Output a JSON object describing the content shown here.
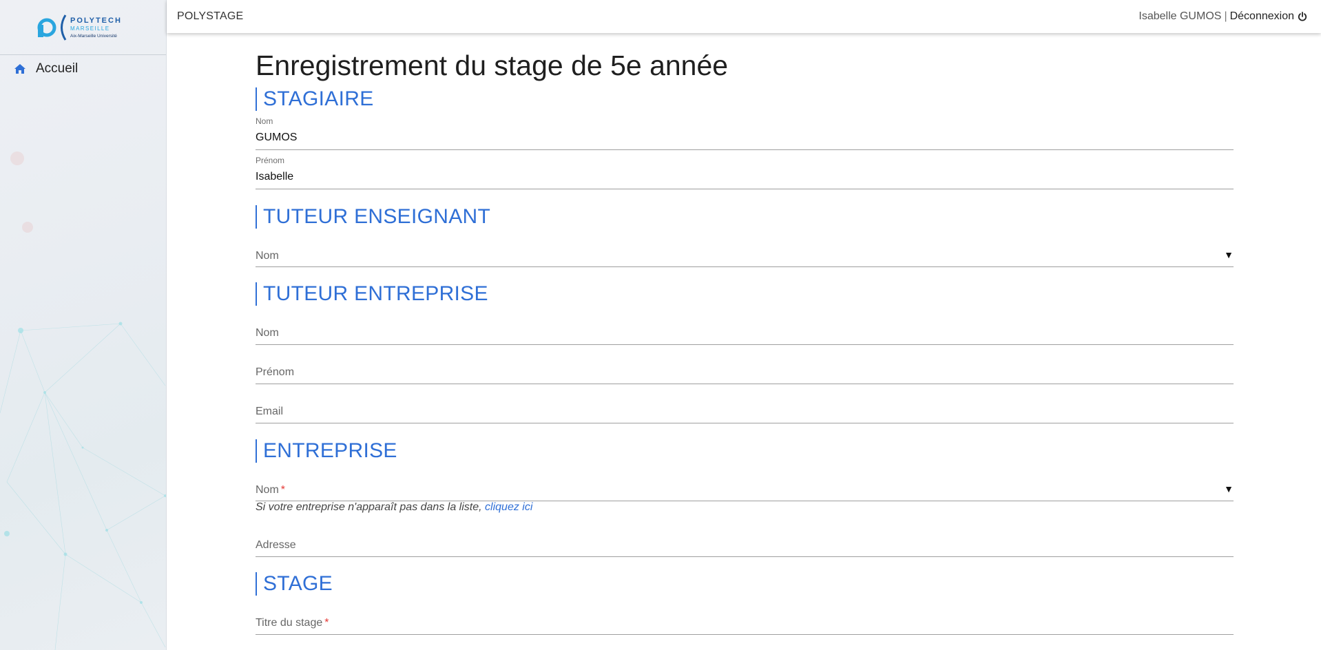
{
  "brand": {
    "logo_word": "POLYTECH",
    "logo_city": "MARSEILLE",
    "logo_univ": "Aix-Marseille Université",
    "primary_color": "#2f6fd6",
    "required_color": "#e53935"
  },
  "sidebar": {
    "items": [
      {
        "label": "Accueil",
        "icon": "home-icon"
      }
    ]
  },
  "topbar": {
    "app_name": "POLYSTAGE",
    "user_name": "Isabelle GUMOS",
    "separator": "|",
    "logout_label": "Déconnexion",
    "logout_icon": "power-icon"
  },
  "page": {
    "title": "Enregistrement du stage de 5e année"
  },
  "sections": {
    "stagiaire": {
      "title": "STAGIAIRE",
      "nom_label": "Nom",
      "nom_value": "GUMOS",
      "prenom_label": "Prénom",
      "prenom_value": "Isabelle"
    },
    "tuteur_enseignant": {
      "title": "TUTEUR ENSEIGNANT",
      "nom_placeholder": "Nom"
    },
    "tuteur_entreprise": {
      "title": "TUTEUR ENTREPRISE",
      "nom_placeholder": "Nom",
      "prenom_placeholder": "Prénom",
      "email_placeholder": "Email"
    },
    "entreprise": {
      "title": "ENTREPRISE",
      "nom_placeholder": "Nom",
      "required_mark": "*",
      "hint_text": "Si votre entreprise n'apparaît pas dans la liste,",
      "hint_link": "cliquez ici",
      "adresse_placeholder": "Adresse"
    },
    "stage": {
      "title": "STAGE",
      "titre_placeholder": "Titre du stage",
      "required_mark": "*"
    }
  }
}
